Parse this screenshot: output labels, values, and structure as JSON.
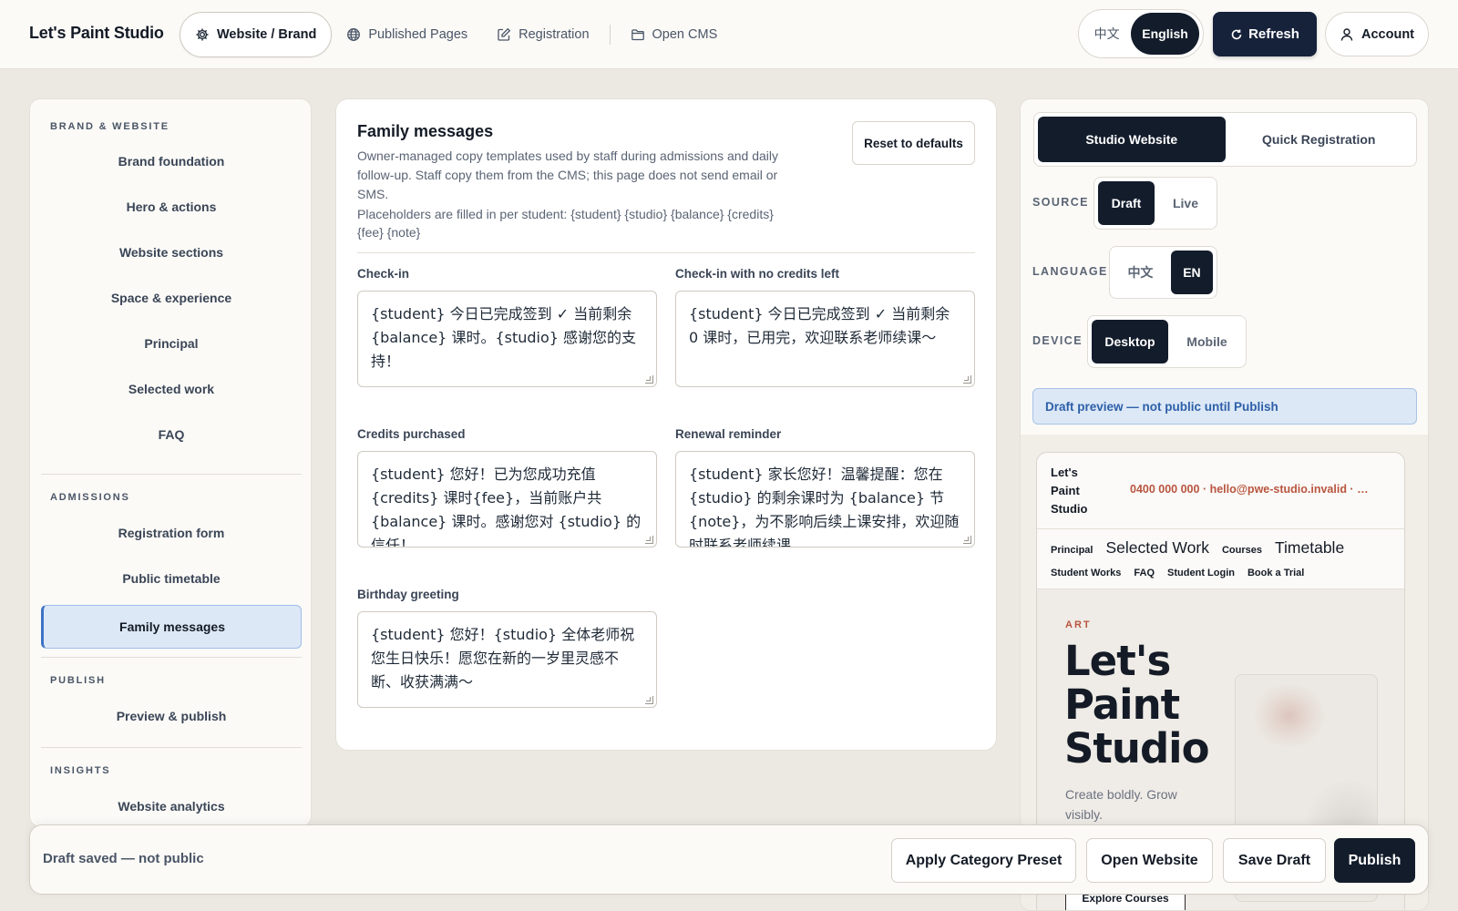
{
  "app": {
    "title": "Let's Paint Studio"
  },
  "nav": {
    "website_brand": "Website / Brand",
    "published_pages": "Published Pages",
    "registration": "Registration",
    "open_cms": "Open CMS"
  },
  "language": {
    "zh": "中文",
    "en": "English",
    "selected": "English"
  },
  "toolbar": {
    "refresh": "Refresh",
    "account": "Account"
  },
  "sidebar": {
    "sections": [
      {
        "title": "BRAND & WEBSITE",
        "items": [
          "Brand foundation",
          "Hero & actions",
          "Website sections",
          "Space & experience",
          "Principal",
          "Selected work",
          "FAQ"
        ]
      },
      {
        "title": "ADMISSIONS",
        "items": [
          "Registration form",
          "Public timetable",
          "Family messages"
        ]
      },
      {
        "title": "PUBLISH",
        "items": [
          "Preview & publish"
        ]
      },
      {
        "title": "INSIGHTS",
        "items": [
          "Website analytics"
        ]
      }
    ],
    "active": "Family messages"
  },
  "main": {
    "title": "Family messages",
    "description": "Owner-managed copy templates used by staff during admissions and daily follow-up. Staff copy them from the CMS; this page does not send email or SMS.",
    "placeholders_note": "Placeholders are filled in per student: {student} {studio} {balance} {credits} {fee} {note}",
    "reset_button": "Reset to defaults",
    "fields": [
      {
        "label": "Check-in",
        "value": "{student} 今日已完成签到 ✓ 当前剩余 {balance} 课时。{studio} 感谢您的支持！"
      },
      {
        "label": "Check-in with no credits left",
        "value": "{student} 今日已完成签到 ✓ 当前剩余 0 课时，已用完，欢迎联系老师续课～"
      },
      {
        "label": "Credits purchased",
        "value": "{student} 您好！已为您成功充值 {credits} 课时{fee}，当前账户共 {balance} 课时。感谢您对 {studio} 的信任！"
      },
      {
        "label": "Renewal reminder",
        "value": "{student} 家长您好！温馨提醒：您在 {studio} 的剩余课时为 {balance} 节 {note}，为不影响后续上课安排，欢迎随时联系老师续课。"
      },
      {
        "label": "Birthday greeting",
        "value": "{student} 您好！{studio} 全体老师祝您生日快乐！愿您在新的一岁里灵感不断、收获满满～"
      }
    ]
  },
  "preview": {
    "tabs": [
      "Studio Website",
      "Quick Registration"
    ],
    "active_tab": "Studio Website",
    "source": {
      "label": "SOURCE",
      "options": [
        "Draft",
        "Live"
      ],
      "selected": "Draft"
    },
    "language": {
      "label": "LANGUAGE",
      "options": [
        "中文",
        "EN"
      ],
      "selected": "EN"
    },
    "device": {
      "label": "DEVICE",
      "options": [
        "Desktop",
        "Mobile"
      ],
      "selected": "Desktop"
    },
    "banner": "Draft preview — not public until Publish",
    "site": {
      "logo": "Let's Paint Studio",
      "contact": "0400 000 000 · hello@pwe-studio.invalid · …",
      "nav_row1": [
        "Principal",
        "Selected Work",
        "Courses",
        "Timetable"
      ],
      "nav_row2": [
        "Student Works",
        "FAQ",
        "Student Login",
        "Book a Trial"
      ],
      "kicker": "ART",
      "hero_title": "Let's Paint Studio",
      "hero_subtitle": "Create boldly. Grow visibly.",
      "cta": "Explore Courses"
    }
  },
  "bottom_bar": {
    "status": "Draft saved — not public",
    "apply_preset": "Apply Category Preset",
    "open_website": "Open Website",
    "save_draft": "Save Draft",
    "publish": "Publish"
  },
  "colors": {
    "primary_dark": "#131c2b",
    "accent_blue": "#3e73c4",
    "accent_rust": "#b8553f",
    "page_bg": "#ece9e3"
  }
}
